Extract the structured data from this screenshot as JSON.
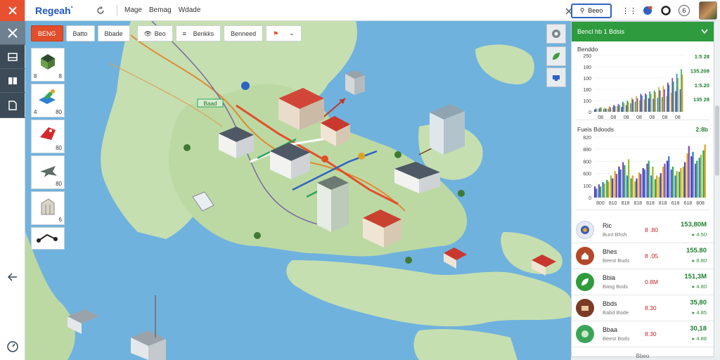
{
  "brand": {
    "name": "Regeah",
    "mark": "°"
  },
  "topbar": {
    "links": [
      "Mage",
      "Bemag",
      "Wdade"
    ],
    "search_label": "Beeo",
    "badge": "6"
  },
  "filters": {
    "chips": [
      "BENG",
      "Batto",
      "Bbade",
      "Beo",
      "Benkks",
      "Benneed"
    ],
    "active_index": 0
  },
  "palette": {
    "items": [
      {
        "name": "town-hall",
        "count": "8",
        "count_left": "8"
      },
      {
        "name": "factory",
        "count": "80",
        "count_left": "4"
      },
      {
        "name": "sale-tag",
        "count": "80",
        "count_left": ""
      },
      {
        "name": "plane",
        "count": "80",
        "count_left": ""
      },
      {
        "name": "warehouse",
        "count": "6",
        "count_left": ""
      },
      {
        "name": "route",
        "count": "",
        "count_left": ""
      }
    ]
  },
  "map": {
    "road_label": "Baad"
  },
  "panel": {
    "title": "Bencl hb 1 Bdsis",
    "chart1": {
      "title": "Benddo",
      "right_labels": [
        "1:5 28",
        "135.208",
        "1:5.20",
        "135 28"
      ],
      "yticks": [
        "250",
        "180",
        "100",
        "180",
        "100",
        "0"
      ],
      "xticks": [
        "08",
        "08",
        "08",
        "08",
        "08",
        "08",
        "08"
      ]
    },
    "chart2": {
      "title": "Fueis Bdoods",
      "right_label": "2:8b",
      "yticks": [
        "820",
        "880",
        "800",
        "600",
        "100",
        "0"
      ],
      "xticks": [
        "800",
        "810",
        "818",
        "818",
        "818",
        "818",
        "618",
        "618",
        "808"
      ]
    },
    "rows": [
      {
        "name": "Ric",
        "sub": "Bunt Bhsh",
        "val": "8 .80",
        "big": "153,80M",
        "delta": "▸ 4.50"
      },
      {
        "name": "Bhes",
        "sub": "Beest Buds",
        "val": "8 .05",
        "big": "155.80",
        "delta": "▸ 8.80"
      },
      {
        "name": "Bbia",
        "sub": "Basg Bods",
        "val": "0.8M",
        "big": "151,3M",
        "delta": "▸ 4.80"
      },
      {
        "name": "Bbds",
        "sub": "Babd Bode",
        "val": "8.30",
        "big": "35,80",
        "delta": "▸ 4.85"
      },
      {
        "name": "Bbaa",
        "sub": "Beest Bods",
        "val": "8.30",
        "big": "30,18",
        "delta": "▸ 4.88"
      }
    ],
    "more_label": "Bbeo"
  },
  "colors": {
    "accent": "#e24e2a",
    "panel_header": "#2e9b3e",
    "water": "#6fb2dd",
    "land": "#c6dfb0",
    "bar_palette": [
      "#5a3ba8",
      "#7a4fc4",
      "#2f7fd6",
      "#2eaa57",
      "#9bbb2b",
      "#e0a122"
    ]
  },
  "chart_data": [
    {
      "type": "bar",
      "title": "Benddo",
      "ylim": [
        0,
        250
      ],
      "categories": [
        "08",
        "08",
        "08",
        "08",
        "08",
        "08",
        "08"
      ],
      "series": [
        {
          "values": [
            10,
            15,
            12,
            14,
            20,
            25,
            22,
            30,
            38,
            45,
            50,
            55,
            60,
            58,
            62,
            65,
            70,
            85,
            92,
            100
          ]
        },
        {
          "values": [
            15,
            20,
            18,
            25,
            30,
            35,
            45,
            50,
            62,
            70,
            80,
            82,
            90,
            95,
            110,
            115,
            130,
            150,
            170,
            190
          ]
        },
        {
          "values": [
            12,
            18,
            14,
            20,
            26,
            30,
            38,
            44,
            55,
            60,
            72,
            76,
            80,
            88,
            95,
            100,
            120,
            135,
            150,
            165
          ]
        }
      ]
    },
    {
      "type": "bar",
      "title": "Fueis Bdoods",
      "ylim": [
        0,
        820
      ],
      "categories": [
        "800",
        "810",
        "818",
        "818",
        "818",
        "818",
        "618",
        "618",
        "808"
      ],
      "series": [
        {
          "values": [
            150,
            180,
            210,
            240,
            300,
            360,
            420,
            480,
            300,
            260,
            220,
            340,
            400,
            460,
            300,
            250,
            280,
            420,
            500,
            380,
            300,
            350,
            420,
            600,
            560,
            460,
            540,
            640
          ]
        },
        {
          "values": [
            120,
            150,
            190,
            220,
            260,
            320,
            380,
            440,
            520,
            300,
            260,
            320,
            380,
            500,
            420,
            300,
            330,
            460,
            560,
            420,
            360,
            400,
            480,
            700,
            620,
            500,
            580,
            720
          ]
        }
      ]
    }
  ]
}
